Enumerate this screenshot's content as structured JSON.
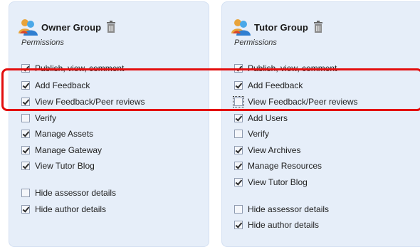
{
  "owner_group": {
    "title": "Owner Group",
    "permissions_label": "Permissions",
    "items": [
      {
        "label": "Publish, view, comment",
        "checked": true
      },
      {
        "label": "Add Feedback",
        "checked": true
      },
      {
        "label": "View Feedback/Peer reviews",
        "checked": true
      },
      {
        "label": "Verify",
        "checked": false
      },
      {
        "label": "Manage Assets",
        "checked": true
      },
      {
        "label": "Manage Gateway",
        "checked": true
      },
      {
        "label": "View Tutor Blog",
        "checked": true
      },
      {
        "label": "Hide assessor details",
        "checked": false
      },
      {
        "label": "Hide author details",
        "checked": true
      }
    ]
  },
  "tutor_group": {
    "title": "Tutor Group",
    "permissions_label": "Permissions",
    "items": [
      {
        "label": "Publish, view, comment",
        "checked": true
      },
      {
        "label": "Add Feedback",
        "checked": true
      },
      {
        "label": "View Feedback/Peer reviews",
        "checked": false
      },
      {
        "label": "Add Users",
        "checked": true
      },
      {
        "label": "Verify",
        "checked": false
      },
      {
        "label": "View Archives",
        "checked": true
      },
      {
        "label": "Manage Resources",
        "checked": true
      },
      {
        "label": "View Tutor Blog",
        "checked": true
      },
      {
        "label": "Hide assessor details",
        "checked": false
      },
      {
        "label": "Hide author details",
        "checked": true
      }
    ]
  },
  "colors": {
    "panel_bg": "#e6eef9",
    "highlight": "#e30d0d"
  },
  "icons": {
    "group": "group-users-icon",
    "delete": "trash-icon"
  }
}
